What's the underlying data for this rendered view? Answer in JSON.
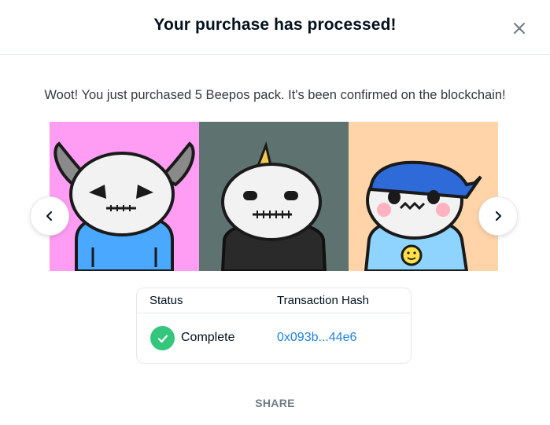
{
  "modal": {
    "title": "Your purchase has processed!",
    "message": "Woot! You just purchased 5 Beepos pack. It's been confirmed on the blockchain!",
    "close_icon": "close-icon"
  },
  "carousel": {
    "prev_icon": "chevron-left-icon",
    "next_icon": "chevron-right-icon",
    "items": [
      {
        "name": "beepo-horned-blue-hoodie",
        "background": "#ff9cf3"
      },
      {
        "name": "beepo-party-hat-black-coat",
        "background": "#5e7270"
      },
      {
        "name": "beepo-blue-bandana-smiley",
        "background": "#ffd4a8"
      }
    ]
  },
  "transaction": {
    "headers": {
      "status": "Status",
      "hash": "Transaction Hash"
    },
    "status_value": "Complete",
    "status_icon": "check-circle-icon",
    "hash_value": "0x093b...44e6"
  },
  "footer": {
    "share_label": "SHARE"
  },
  "colors": {
    "accent_link": "#2081e2",
    "success": "#34c77b",
    "border": "#e5e8eb",
    "muted_text": "#707a83"
  }
}
